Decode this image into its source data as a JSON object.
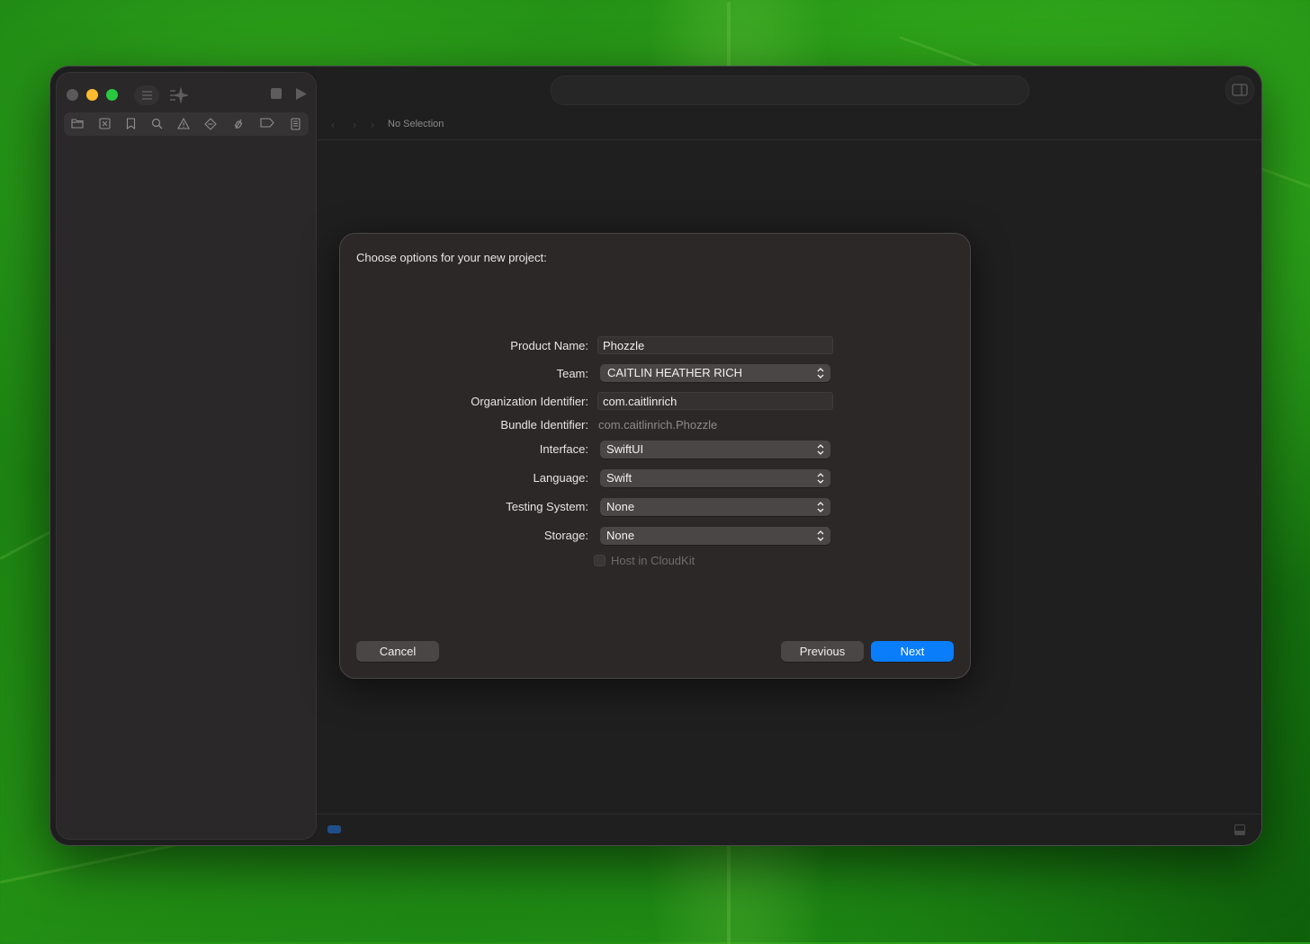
{
  "window": {
    "traffic_lights": [
      "close",
      "minimize",
      "zoom"
    ],
    "toolbar_icons": [
      "sidebar-toggle-icon",
      "sparkle-icon",
      "stop-icon",
      "run-icon"
    ],
    "navigator_icons": [
      "folder-icon",
      "source-control-icon",
      "bookmark-icon",
      "find-icon",
      "issue-icon",
      "test-icon",
      "debug-icon",
      "breakpoint-icon",
      "report-icon"
    ]
  },
  "jump_bar": {
    "selection": "No Selection"
  },
  "dialog": {
    "title": "Choose options for your new project:",
    "product_name": {
      "label": "Product Name:",
      "value": "Phozzle"
    },
    "team": {
      "label": "Team:",
      "value": "CAITLIN HEATHER RICH"
    },
    "organization_identifier": {
      "label": "Organization Identifier:",
      "value": "com.caitlinrich"
    },
    "bundle_identifier": {
      "label": "Bundle Identifier:",
      "value": "com.caitlinrich.Phozzle"
    },
    "interface": {
      "label": "Interface:",
      "value": "SwiftUI"
    },
    "language": {
      "label": "Language:",
      "value": "Swift"
    },
    "testing_system": {
      "label": "Testing System:",
      "value": "None"
    },
    "storage": {
      "label": "Storage:",
      "value": "None"
    },
    "host_in_cloudkit": {
      "label": "Host in CloudKit",
      "checked": false,
      "enabled": false
    },
    "buttons": {
      "cancel": "Cancel",
      "previous": "Previous",
      "next": "Next"
    }
  },
  "colors": {
    "accent": "#0a7dfa",
    "close": "#5b5a5a",
    "minimize": "#febc2e",
    "zoom": "#28c840"
  }
}
